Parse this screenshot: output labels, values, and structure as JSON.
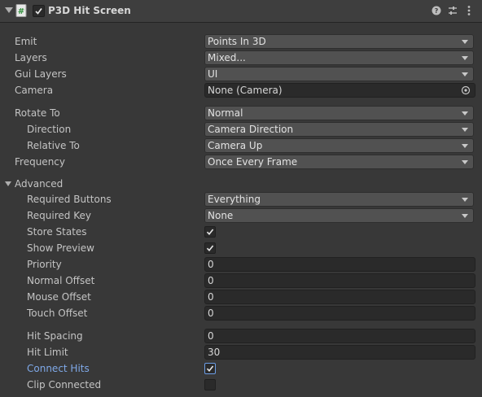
{
  "header": {
    "title": "P3D Hit Screen",
    "script_icon": "script-icon",
    "enabled": true,
    "icons": [
      "help-icon",
      "preset-icon",
      "context-menu-icon"
    ]
  },
  "fields": {
    "emit": {
      "label": "Emit",
      "value": "Points In 3D"
    },
    "layers": {
      "label": "Layers",
      "value": "Mixed..."
    },
    "gui_layers": {
      "label": "Gui Layers",
      "value": "UI"
    },
    "camera": {
      "label": "Camera",
      "value": "None (Camera)"
    },
    "rotate_to": {
      "label": "Rotate To",
      "value": "Normal"
    },
    "direction": {
      "label": "Direction",
      "value": "Camera Direction"
    },
    "relative_to": {
      "label": "Relative To",
      "value": "Camera Up"
    },
    "frequency": {
      "label": "Frequency",
      "value": "Once Every Frame"
    }
  },
  "advanced": {
    "label": "Advanced",
    "expanded": true,
    "required_buttons": {
      "label": "Required Buttons",
      "value": "Everything"
    },
    "required_key": {
      "label": "Required Key",
      "value": "None"
    },
    "store_states": {
      "label": "Store States",
      "checked": true
    },
    "show_preview": {
      "label": "Show Preview",
      "checked": true
    },
    "priority": {
      "label": "Priority",
      "value": "0"
    },
    "normal_offset": {
      "label": "Normal Offset",
      "value": "0"
    },
    "mouse_offset": {
      "label": "Mouse Offset",
      "value": "0"
    },
    "touch_offset": {
      "label": "Touch Offset",
      "value": "0"
    },
    "hit_spacing": {
      "label": "Hit Spacing",
      "value": "0"
    },
    "hit_limit": {
      "label": "Hit Limit",
      "value": "30"
    },
    "connect_hits": {
      "label": "Connect Hits",
      "checked": true
    },
    "clip_connected": {
      "label": "Clip Connected",
      "checked": false
    }
  },
  "colors": {
    "background": "#383838",
    "dropdown": "#515151",
    "field": "#2a2a2a",
    "accent": "#7fa9e8"
  }
}
